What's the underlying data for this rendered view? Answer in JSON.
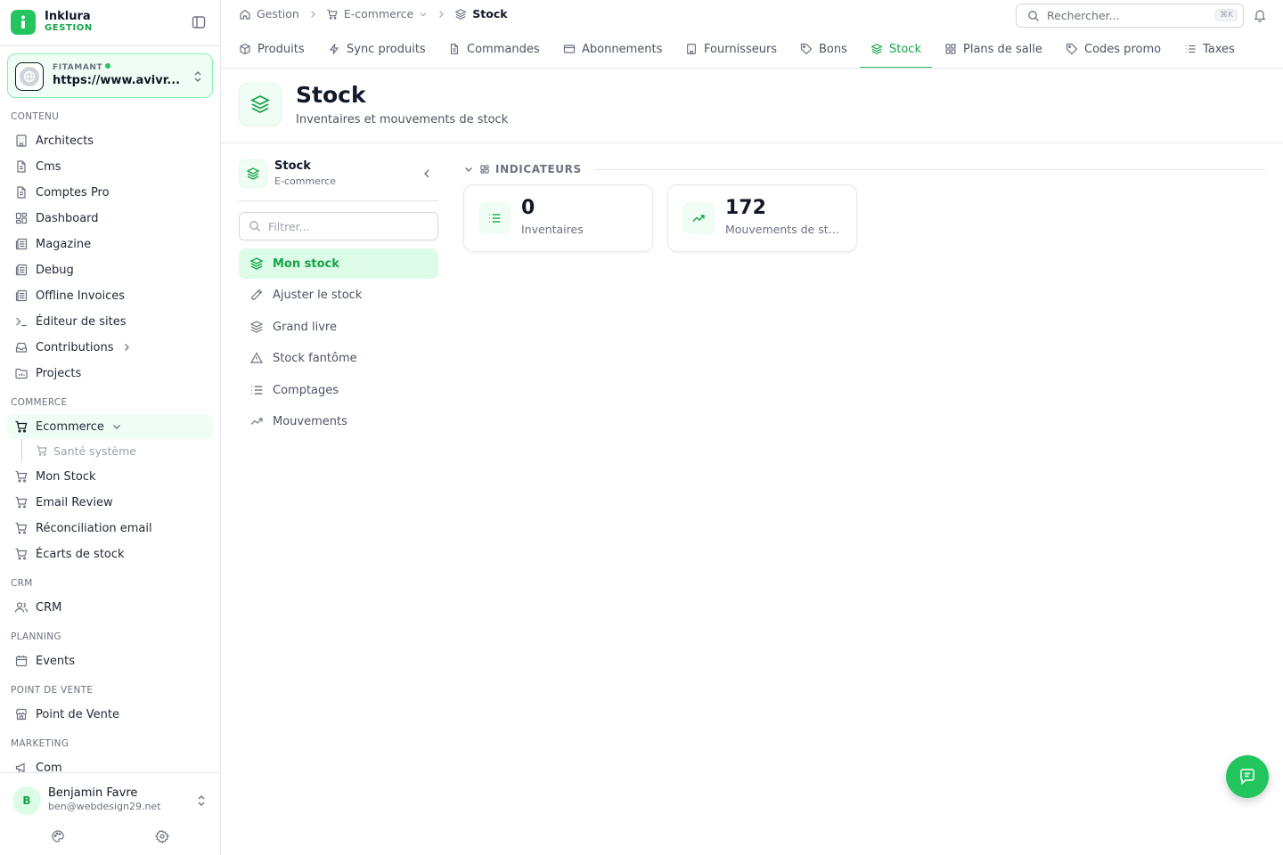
{
  "brand": {
    "name": "Inklura",
    "subtitle": "GESTION"
  },
  "site": {
    "label": "FITAMANT",
    "url": "https://www.avivr..."
  },
  "sidebar": {
    "sections": [
      {
        "title": "CONTENU"
      },
      {
        "title": "COMMERCE"
      },
      {
        "title": "CRM"
      },
      {
        "title": "PLANNING"
      },
      {
        "title": "POINT DE VENTE"
      },
      {
        "title": "MARKETING"
      }
    ],
    "contenu": [
      "Architects",
      "Cms",
      "Comptes Pro",
      "Dashboard",
      "Magazine",
      "Debug",
      "Offline Invoices",
      "Éditeur de sites",
      "Contributions",
      "Projects"
    ],
    "commerce": [
      "Ecommerce",
      "Mon Stock",
      "Email Review",
      "Réconciliation email",
      "Écarts de stock"
    ],
    "commerce_sub": [
      "Santé système"
    ],
    "crm": [
      "CRM"
    ],
    "planning": [
      "Events"
    ],
    "pos": [
      "Point de Vente"
    ],
    "marketing": [
      "Com"
    ]
  },
  "user": {
    "initial": "B",
    "name": "Benjamin Favre",
    "email": "ben@webdesign29.net"
  },
  "breadcrumb": {
    "home": "Gestion",
    "section": "E-commerce",
    "current": "Stock"
  },
  "search": {
    "placeholder": "Rechercher...",
    "shortcut": "⌘K"
  },
  "tabs": [
    "Produits",
    "Sync produits",
    "Commandes",
    "Abonnements",
    "Fournisseurs",
    "Bons",
    "Stock",
    "Plans de salle",
    "Codes promo",
    "Taxes"
  ],
  "active_tab": "Stock",
  "page": {
    "title": "Stock",
    "subtitle": "Inventaires et mouvements de stock"
  },
  "subnav": {
    "title": "Stock",
    "subtitle": "E-commerce",
    "filter_placeholder": "Filtrer...",
    "items": [
      "Mon stock",
      "Ajuster le stock",
      "Grand livre",
      "Stock fantôme",
      "Comptages",
      "Mouvements"
    ],
    "active": "Mon stock"
  },
  "indicators": {
    "title": "INDICATEURS",
    "cards": [
      {
        "value": "0",
        "label": "Inventaires",
        "icon": "list-icon"
      },
      {
        "value": "172",
        "label": "Mouvements de stock",
        "icon": "trending-up-icon"
      }
    ]
  },
  "colors": {
    "accent": "#22c55e",
    "accent_dark": "#16a34a",
    "accent_bg": "#f0fdf4"
  }
}
